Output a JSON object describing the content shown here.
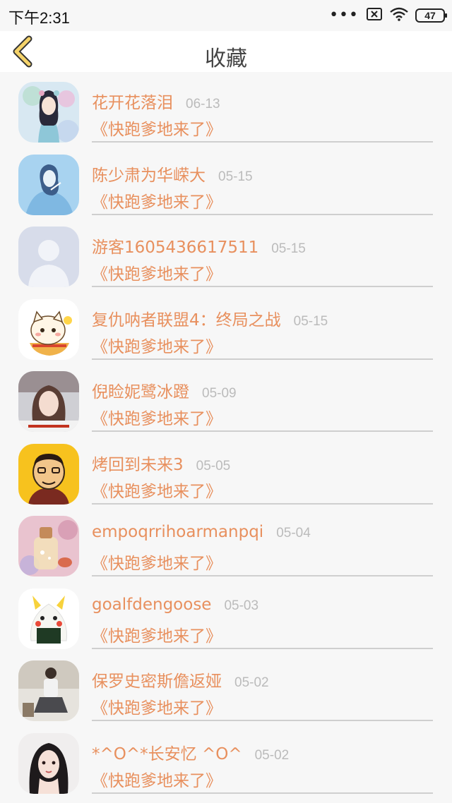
{
  "status_bar": {
    "time": "下午2:31",
    "battery": "47",
    "icons": [
      "more-dots-icon",
      "sim-off-icon",
      "wifi-icon",
      "battery-icon"
    ]
  },
  "header": {
    "title": "收藏",
    "back_icon": "chevron-left-icon",
    "accent_color": "#f5d36a"
  },
  "colors": {
    "name": "#e8905e",
    "date": "#bbbbbb",
    "divider": "#cfcfcf",
    "background": "#f7f7f7"
  },
  "favorites": [
    {
      "name": "花开花落泪",
      "date": "06-13",
      "book": "《快跑爹地来了》",
      "avatar": "anime-girl-avatar"
    },
    {
      "name": "陈少肃为华嵘大",
      "date": "05-15",
      "book": "《快跑爹地来了》",
      "avatar": "blue-sketch-girl-avatar"
    },
    {
      "name": "游客1605436617511",
      "date": "05-15",
      "book": "《快跑爹地来了》",
      "avatar": "default-user-avatar"
    },
    {
      "name": "复仇呐者联盟4：终局之战",
      "date": "05-15",
      "book": "《快跑爹地来了》",
      "avatar": "cartoon-cat-avatar"
    },
    {
      "name": "倪睑妮鹭冰蹬",
      "date": "05-09",
      "book": "《快跑爹地来了》",
      "avatar": "girl-photo-avatar"
    },
    {
      "name": "烤回到未来3",
      "date": "05-05",
      "book": "《快跑爹地来了》",
      "avatar": "cartoon-man-avatar"
    },
    {
      "name": "empoqrrihoarmanpqi",
      "date": "05-04",
      "book": "《快跑爹地来了》",
      "avatar": "glass-bottle-avatar"
    },
    {
      "name": "goalfdengoose",
      "date": "05-03",
      "book": "《快跑爹地来了》",
      "avatar": "pikachu-riceball-avatar"
    },
    {
      "name": "保罗史密斯儋返娅",
      "date": "05-02",
      "book": "《快跑爹地来了》",
      "avatar": "man-sitting-avatar"
    },
    {
      "name": "*^O^*长安忆 ^O^",
      "date": "05-02",
      "book": "《快跑爹地来了》",
      "avatar": "girl-portrait-avatar"
    }
  ]
}
